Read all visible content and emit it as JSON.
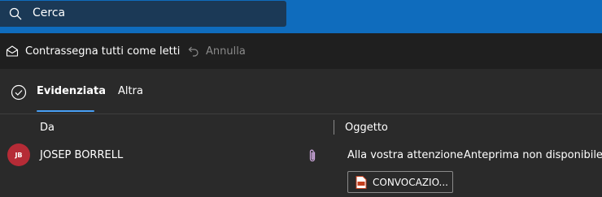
{
  "search": {
    "placeholder": "Cerca",
    "icon": "search-icon"
  },
  "commands": {
    "mark_all_read": {
      "label": "Contrassegna tutti come letti",
      "icon": "envelope-open-icon"
    },
    "undo": {
      "label": "Annulla",
      "icon": "undo-icon",
      "enabled": false
    }
  },
  "pivots": {
    "select_icon": "circle-check-icon",
    "tabs": [
      {
        "label": "Evidenziata",
        "selected": true
      },
      {
        "label": "Altra",
        "selected": false
      }
    ]
  },
  "columns": {
    "from": "Da",
    "subject": "Oggetto"
  },
  "messages": [
    {
      "avatar_initials": "JB",
      "avatar_color": "#b52b36",
      "sender": "JOSEP BORRELL",
      "has_attachment": true,
      "subject": "Alla vostra attenzione",
      "preview": "Anteprima non disponibile.",
      "attachment_name": "CONVOCAZIO..."
    }
  ],
  "colors": {
    "accent": "#0f6cbd",
    "tab_underline": "#479ef5",
    "background": "#2a2a2a",
    "command_bar": "#1f1f1f"
  }
}
